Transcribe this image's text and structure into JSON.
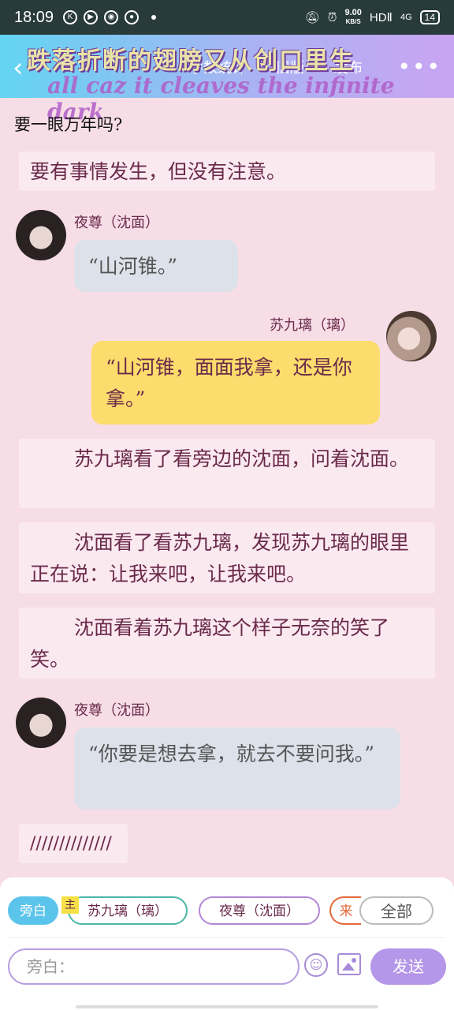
{
  "status": {
    "time": "18:09",
    "speed_value": "9.00",
    "speed_unit": "KB/S",
    "hd": "HDⅡ",
    "signal": "4G",
    "battery": "14"
  },
  "header": {
    "menu": [
      "字数统计",
      "旧版",
      "发布"
    ],
    "overlay_title": "跌落折断的翅膀又从创口里生",
    "overlay_subtitle": "all caz it cleaves the infinite dark"
  },
  "messages": {
    "top_line": "要一眼万年吗?",
    "narr0": "要有事情发生，但没有注意。",
    "m1_speaker": "夜尊（沈面）",
    "m1_text": "“山河锥。”",
    "m2_speaker": "苏九璃（璃）",
    "m2_text": "“山河锥，面面我拿，还是你拿。”",
    "narr1": "苏九璃看了看旁边的沈面，问着沈面。",
    "narr2": "沈面看了看苏九璃，发现苏九璃的眼里正在说：让我来吧，让我来吧。",
    "narr3": "沈面看着苏九璃这个样子无奈的笑了笑。",
    "m3_speaker": "夜尊（沈面）",
    "m3_text": "“你要是想去拿，就去不要问我。”",
    "narr4": "//////////////"
  },
  "composer": {
    "chip_narrator": "旁白",
    "main_tag": "主",
    "chip_char1": "苏九璃（璃）",
    "chip_char2": "夜尊（沈面）",
    "chip_char3": "来",
    "chip_all": "全部",
    "input_placeholder": "旁白：",
    "send_label": "发送"
  },
  "colors": {
    "accent": "#b497e8",
    "narrator_chip": "#5bc4ea",
    "yellow_bubble": "#fcdc6c",
    "gray_bubble": "#dde1ea",
    "background": "#f7dde6"
  }
}
